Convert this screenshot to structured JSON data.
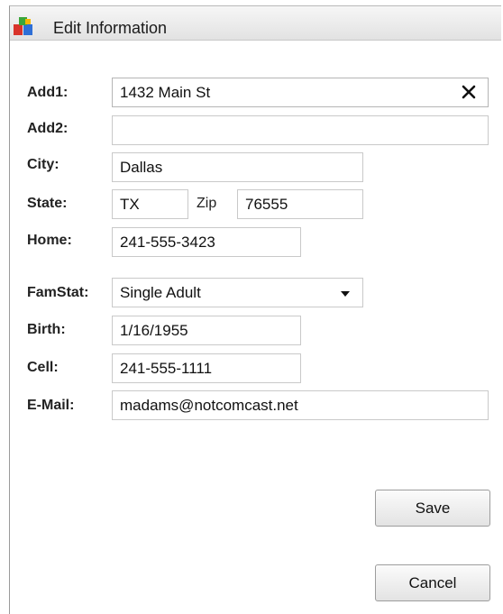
{
  "window": {
    "title": "Edit Information"
  },
  "labels": {
    "add1": "Add1:",
    "add2": "Add2:",
    "city": "City:",
    "state": "State:",
    "zip": "Zip",
    "home": "Home:",
    "famstat": "FamStat:",
    "birth": "Birth:",
    "cell": "Cell:",
    "email": "E-Mail:"
  },
  "fields": {
    "add1": "1432 Main St",
    "add2": "",
    "city": "Dallas",
    "state": "TX",
    "zip": "76555",
    "home": "241-555-3423",
    "famstat": "Single Adult",
    "birth": "1/16/1955",
    "cell": "241-555-1111",
    "email": "madams@notcomcast.net"
  },
  "buttons": {
    "save": "Save",
    "cancel": "Cancel"
  },
  "icons": {
    "app": "app-blocks-icon",
    "clear": "clear-x-icon",
    "dropdown": "chevron-down-icon"
  },
  "colors": {
    "icon_red": "#d9342b",
    "icon_blue": "#2f6fd6",
    "icon_green": "#3aa63a",
    "icon_yellow": "#f2b705"
  }
}
